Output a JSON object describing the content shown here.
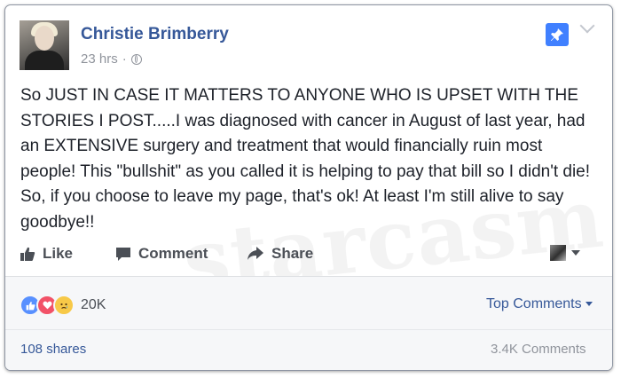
{
  "post": {
    "author": "Christie Brimberry",
    "timestamp": "23 hrs",
    "separator": "·",
    "audience_icon": "globe-icon",
    "text": "So JUST IN CASE IT MATTERS TO ANYONE WHO IS UPSET WITH THE STORIES I POST.....I was diagnosed with cancer in August of last year, had an EXTENSIVE surgery and treatment that would financially ruin most people! This \"bullshit\" as you called it is helping to pay that bill so I didn't die! So, if you choose to leave my page, that's ok! At least I'm still alive to say goodbye!!"
  },
  "header_icons": {
    "pin": "pin-icon",
    "menu": "chevron-down-icon"
  },
  "watermark": "starcasm",
  "actions": {
    "like": "Like",
    "comment": "Comment",
    "share": "Share"
  },
  "reactions": {
    "icons": [
      "like-icon",
      "love-icon",
      "sad-icon"
    ],
    "count": "20K",
    "sort_label": "Top Comments"
  },
  "footer": {
    "shares": "108 shares",
    "comments": "3.4K Comments"
  },
  "colors": {
    "link": "#365899",
    "pin_bg": "#4080ff",
    "like": "#5890ff",
    "love": "#f25268",
    "sad": "#f7c948"
  }
}
